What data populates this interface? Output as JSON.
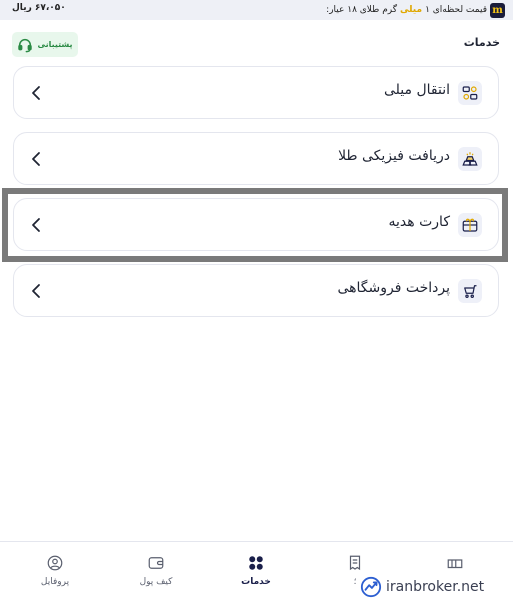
{
  "topbar": {
    "price_prefix": "قیمت لحظه‌ای ۱",
    "brand": "میلی",
    "price_suffix": "گرم طلای ۱۸ عیار:",
    "logo_letter": "m",
    "price_value": "۶۷،۰۵۰ ریال"
  },
  "header": {
    "title": "خدمات",
    "support_label": "پشتیبانی"
  },
  "services": [
    {
      "label": "انتقال میلی",
      "icon": "transfer-icon"
    },
    {
      "label": "دریافت فیزیکی طلا",
      "icon": "gold-bars-icon"
    },
    {
      "label": "کارت هدیه",
      "icon": "gift-card-icon"
    },
    {
      "label": "پرداخت فروشگاهی",
      "icon": "shopping-cart-icon"
    }
  ],
  "bottom_nav": {
    "profile": "پروفایل",
    "wallet": "کیف پول",
    "services": "خدمات",
    "orders": "؛"
  },
  "watermark": "iranbroker.net",
  "colors": {
    "accent": "#1a1f4a",
    "gold": "#e0a800",
    "support_bg": "#e8f7ec",
    "support_fg": "#2a8a44",
    "highlight": "#7a7a7a"
  }
}
